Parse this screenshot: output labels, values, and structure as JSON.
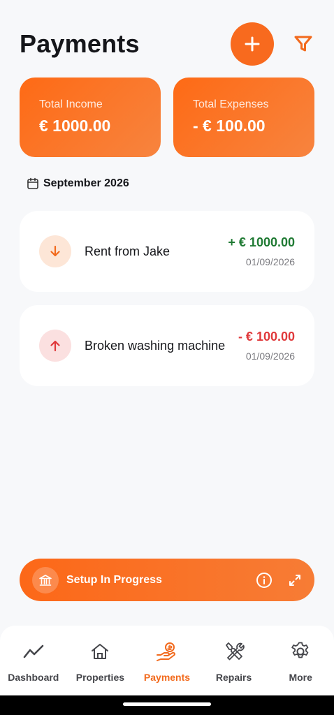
{
  "header": {
    "title": "Payments"
  },
  "summary": {
    "income_label": "Total Income",
    "income_value": "€ 1000.00",
    "expenses_label": "Total Expenses",
    "expenses_value": "- € 100.00"
  },
  "month": {
    "label": "September 2026"
  },
  "transactions": [
    {
      "name": "Rent from Jake",
      "amount": "+ € 1000.00",
      "date": "01/09/2026",
      "direction": "in"
    },
    {
      "name": "Broken washing machine",
      "amount": "- € 100.00",
      "date": "01/09/2026",
      "direction": "out"
    }
  ],
  "setup_banner": {
    "label": "Setup In Progress"
  },
  "tabs": [
    {
      "label": "Dashboard",
      "icon": "chart-line-icon"
    },
    {
      "label": "Properties",
      "icon": "home-icon"
    },
    {
      "label": "Payments",
      "icon": "hand-coin-icon",
      "active": true
    },
    {
      "label": "Repairs",
      "icon": "tools-icon"
    },
    {
      "label": "More",
      "icon": "gear-icon"
    }
  ],
  "colors": {
    "accent": "#F86A1E",
    "income": "#1F7A33",
    "expense": "#E0393B",
    "background": "#F7F8FA"
  }
}
